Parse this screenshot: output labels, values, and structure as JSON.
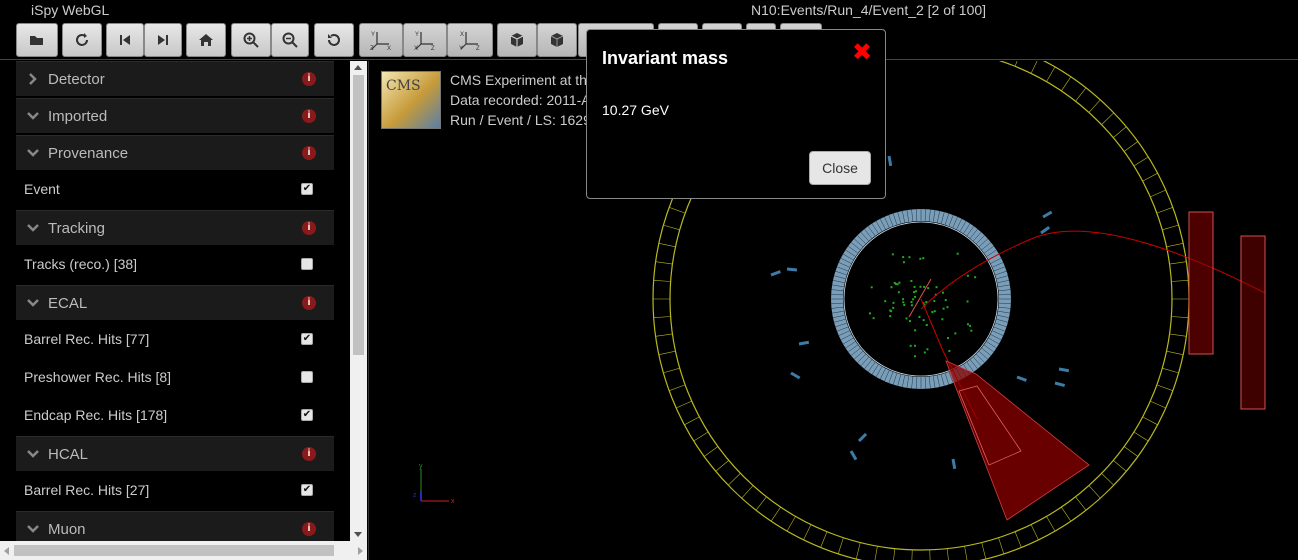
{
  "app": {
    "title": "iSpy WebGL",
    "event_title": "N10:Events/Run_4/Event_2 [2 of 100]"
  },
  "toolbar": {
    "buttons": [
      {
        "name": "open-file-button",
        "icon": "folder-open-icon"
      },
      {
        "name": "reload-button",
        "icon": "reload-icon"
      },
      {
        "name": "previous-event-button",
        "icon": "step-backward-icon"
      },
      {
        "name": "next-event-button",
        "icon": "step-forward-icon"
      },
      {
        "name": "home-view-button",
        "icon": "home-icon"
      },
      {
        "name": "zoom-in-button",
        "icon": "zoom-in-icon"
      },
      {
        "name": "zoom-out-button",
        "icon": "zoom-out-icon"
      },
      {
        "name": "reset-view-button",
        "icon": "undo-icon"
      },
      {
        "name": "view-xy-button",
        "icon": "axes-yx-icon"
      },
      {
        "name": "view-rz-button",
        "icon": "axes-zx-icon"
      },
      {
        "name": "view-rphi-button",
        "icon": "axes-xz-icon"
      },
      {
        "name": "perspective-button",
        "icon": "cube-outline-icon"
      },
      {
        "name": "orthographic-button",
        "icon": "cube-solid-icon"
      }
    ]
  },
  "sidebar": {
    "sections": [
      {
        "label": "Detector",
        "type": "header"
      },
      {
        "label": "Imported",
        "type": "header"
      },
      {
        "label": "Provenance",
        "type": "header"
      },
      {
        "label": "Event",
        "type": "item",
        "checked": true
      },
      {
        "label": "Tracking",
        "type": "header"
      },
      {
        "label": "Tracks (reco.) [38]",
        "type": "item",
        "checked": false
      },
      {
        "label": "ECAL",
        "type": "header"
      },
      {
        "label": "Barrel Rec. Hits [77]",
        "type": "item",
        "checked": true
      },
      {
        "label": "Preshower Rec. Hits [8]",
        "type": "item",
        "checked": false
      },
      {
        "label": "Endcap Rec. Hits [178]",
        "type": "item",
        "checked": true
      },
      {
        "label": "HCAL",
        "type": "header"
      },
      {
        "label": "Barrel Rec. Hits [27]",
        "type": "item",
        "checked": true
      },
      {
        "label": "Muon",
        "type": "header"
      }
    ]
  },
  "event_info": {
    "line1": "CMS Experiment at th",
    "line2": "Data recorded: 2011-A",
    "line3": "Run / Event / LS: 1629"
  },
  "axes": {
    "x": "x",
    "y": "y",
    "z": "z"
  },
  "modal": {
    "title": "Invariant mass",
    "value": "10.27 GeV",
    "close_label": "Close"
  },
  "colors": {
    "ecal_ring": "#8fb8d8",
    "muon_ring": "#b8b820",
    "hcal_tower": "#8b0000",
    "track": "#cc0000",
    "hits": "#22aa22"
  }
}
